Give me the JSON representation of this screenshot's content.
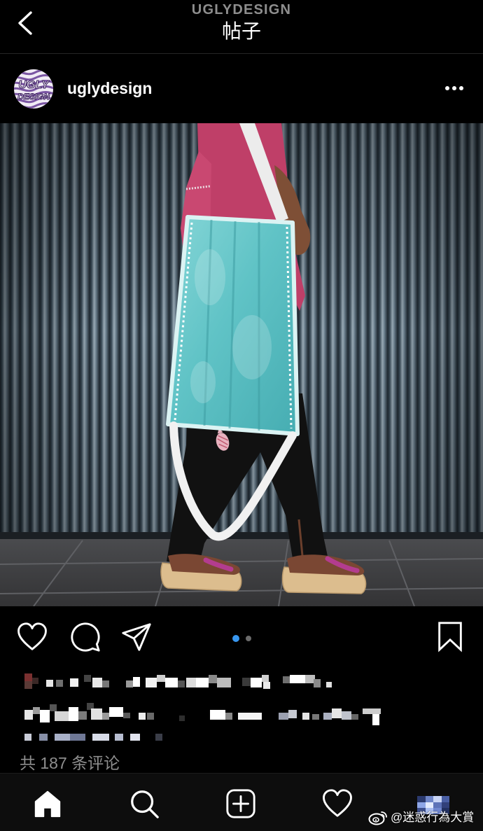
{
  "header": {
    "back_icon": "chevron-left-icon",
    "account_name": "UGLYDESIGN",
    "title": "帖子"
  },
  "post": {
    "avatar_logo": {
      "line1": "UGLY",
      "line2": "DESIGN"
    },
    "username": "uglydesign",
    "more_icon": "more-horizontal-icon",
    "carousel": {
      "slide_count": 2,
      "active_slide": 1
    },
    "comment_count_text": "共 187 条评论"
  },
  "actions": {
    "like_icon": "heart-outline-icon",
    "comment_icon": "comment-bubble-icon",
    "share_icon": "paper-plane-icon",
    "save_icon": "bookmark-outline-icon"
  },
  "bottom_nav": {
    "items": [
      {
        "icon": "home-icon",
        "active": true
      },
      {
        "icon": "search-icon",
        "active": false
      },
      {
        "icon": "add-post-icon",
        "active": false
      },
      {
        "icon": "activity-heart-icon",
        "active": false
      },
      {
        "icon": "profile-avatar",
        "active": false
      }
    ]
  },
  "watermark": {
    "icon": "weibo-logo-icon",
    "text": "@迷惑行為大賞"
  },
  "colors": {
    "background": "#000000",
    "text_primary": "#ffffff",
    "text_secondary": "#8e8e8e",
    "divider": "#262626",
    "carousel_active_dot": "#3897f0",
    "carousel_inactive_dot": "#6b6b6b"
  }
}
